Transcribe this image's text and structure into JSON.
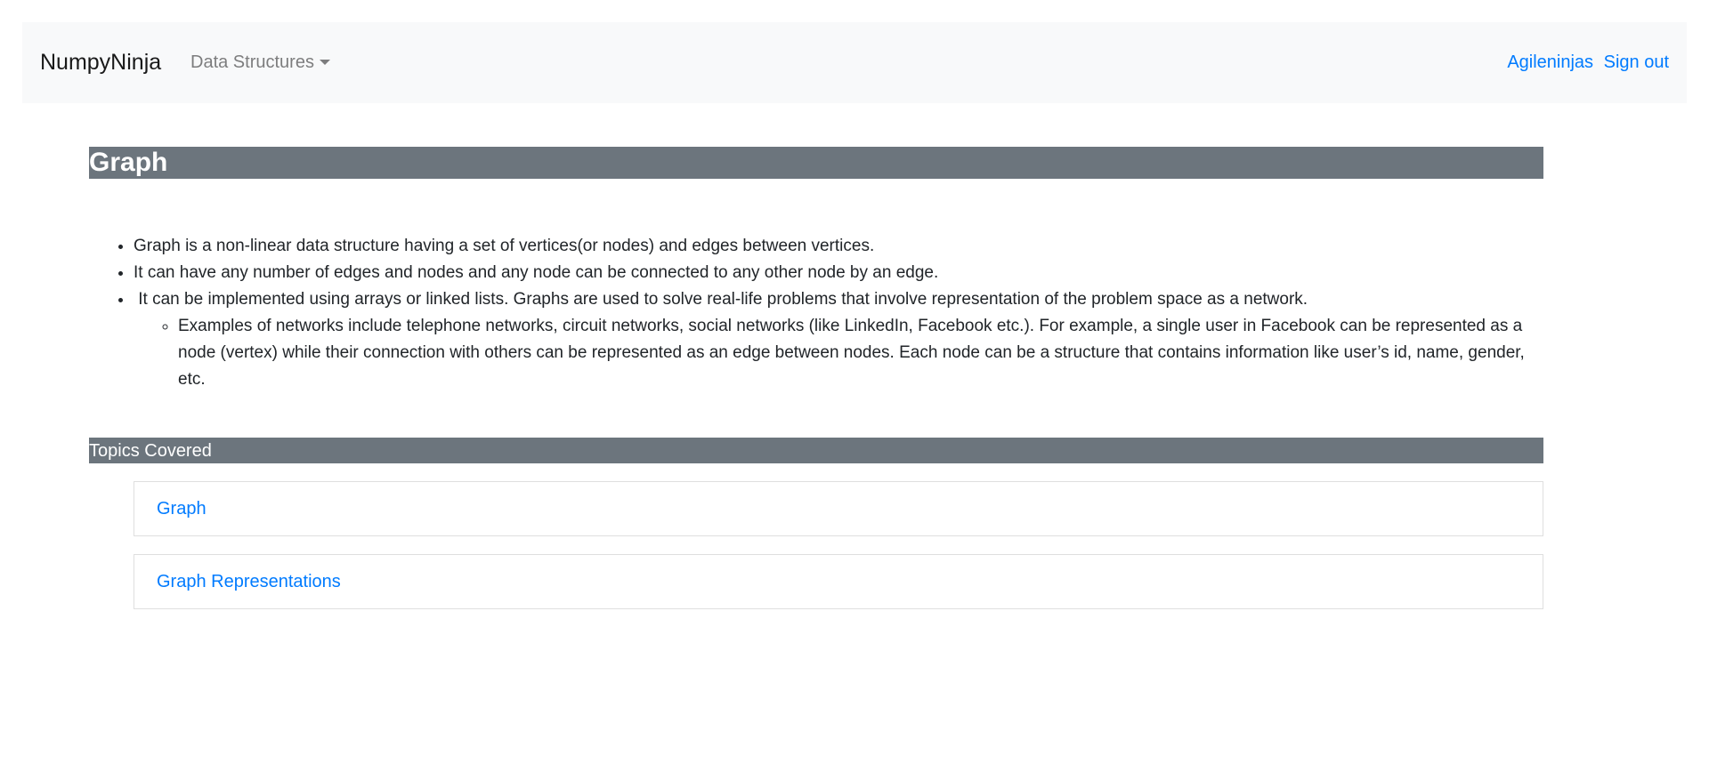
{
  "navbar": {
    "brand": "NumpyNinja",
    "dropdown_label": "Data Structures",
    "user_label": "Agileninjas",
    "signout_label": "Sign out"
  },
  "page": {
    "title": "Graph",
    "bullets": [
      "Graph is a non-linear data structure having a set of vertices(or nodes) and edges between vertices.",
      "It can have any number of edges and nodes and any node can be connected to any other node by an edge.",
      " It can be implemented using arrays or linked lists. Graphs are used to solve real-life problems that involve representation of the problem space as a network."
    ],
    "sub_bullet": "Examples of networks include telephone networks, circuit networks, social networks (like LinkedIn, Facebook etc.). For example, a single user in Facebook can be represented as a node (vertex) while their connection with others can be represented as an edge between nodes. Each node can be a structure that contains information like user’s id, name, gender, etc."
  },
  "topics": {
    "header": "Topics Covered",
    "items": [
      {
        "label": "Graph"
      },
      {
        "label": "Graph Representations"
      }
    ]
  },
  "colors": {
    "navbar_bg": "#f8f9fa",
    "header_bar_bg": "#6c757d",
    "link": "#007bff"
  }
}
